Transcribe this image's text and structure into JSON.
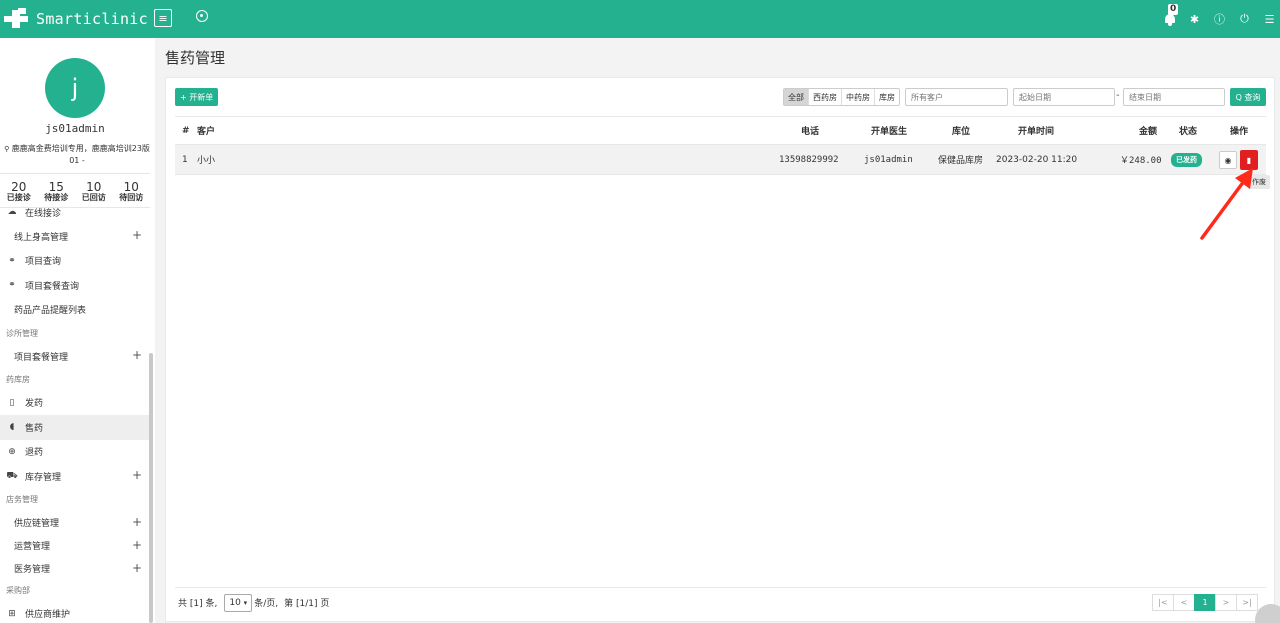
{
  "app": {
    "name": "Smarticlinic"
  },
  "topbar": {
    "notification_count": "0"
  },
  "user": {
    "initial": "j",
    "name": "js01admin",
    "clinic": "鹿鹿高金费培训专用，鹿鹿高培训23版01 -"
  },
  "stats": [
    {
      "value": "20",
      "label": "已接诊"
    },
    {
      "value": "15",
      "label": "待接诊"
    },
    {
      "value": "10",
      "label": "已回访"
    },
    {
      "value": "10",
      "label": "待回访"
    }
  ],
  "nav": {
    "online": "在线接诊",
    "height_mgmt": "线上身高管理",
    "project_query": "项目查询",
    "package_query": "项目套餐查询",
    "drug_reminder": "药品产品提醒列表",
    "sec_clinic": "诊所管理",
    "package_mgmt": "项目套餐管理",
    "sec_pharmacy": "药库房",
    "dispense": "发药",
    "sell": "售药",
    "return": "退药",
    "stock": "库存管理",
    "sec_store": "店务管理",
    "supply": "供应链管理",
    "ops": "运营管理",
    "medical": "医务管理",
    "sec_purchase": "采购部",
    "supplier": "供应商维护"
  },
  "page": {
    "title": "售药管理"
  },
  "toolbar": {
    "new_order": "+ 开新单",
    "filters": [
      "全部",
      "西药房",
      "中药房",
      "库房"
    ],
    "customer_placeholder": "所有客户",
    "start_placeholder": "起始日期",
    "dash": "-",
    "end_placeholder": "结束日期",
    "query": "Q 查询"
  },
  "table": {
    "headers": {
      "idx": "#",
      "customer": "客户",
      "phone": "电话",
      "doctor": "开单医生",
      "location": "库位",
      "time": "开单时间",
      "amount": "金额",
      "status": "状态",
      "action": "操作"
    },
    "rows": [
      {
        "idx": "1",
        "customer": "小小",
        "phone": "13598829992",
        "doctor": "js01admin",
        "location": "保健品库房",
        "time": "2023-02-20 11:20",
        "amount": "￥248.00",
        "status": "已发药"
      }
    ],
    "tooltip": "作废"
  },
  "footer": {
    "total": "共 [1] 条,",
    "page_size": "10",
    "per_page": "条/页,",
    "page_info": "第 [1/1] 页",
    "pager": [
      "|<",
      "<",
      "1",
      ">",
      ">|"
    ]
  },
  "colors": {
    "brand": "#23b18f",
    "danger": "#e02020",
    "arrow": "#ff2a1a"
  }
}
